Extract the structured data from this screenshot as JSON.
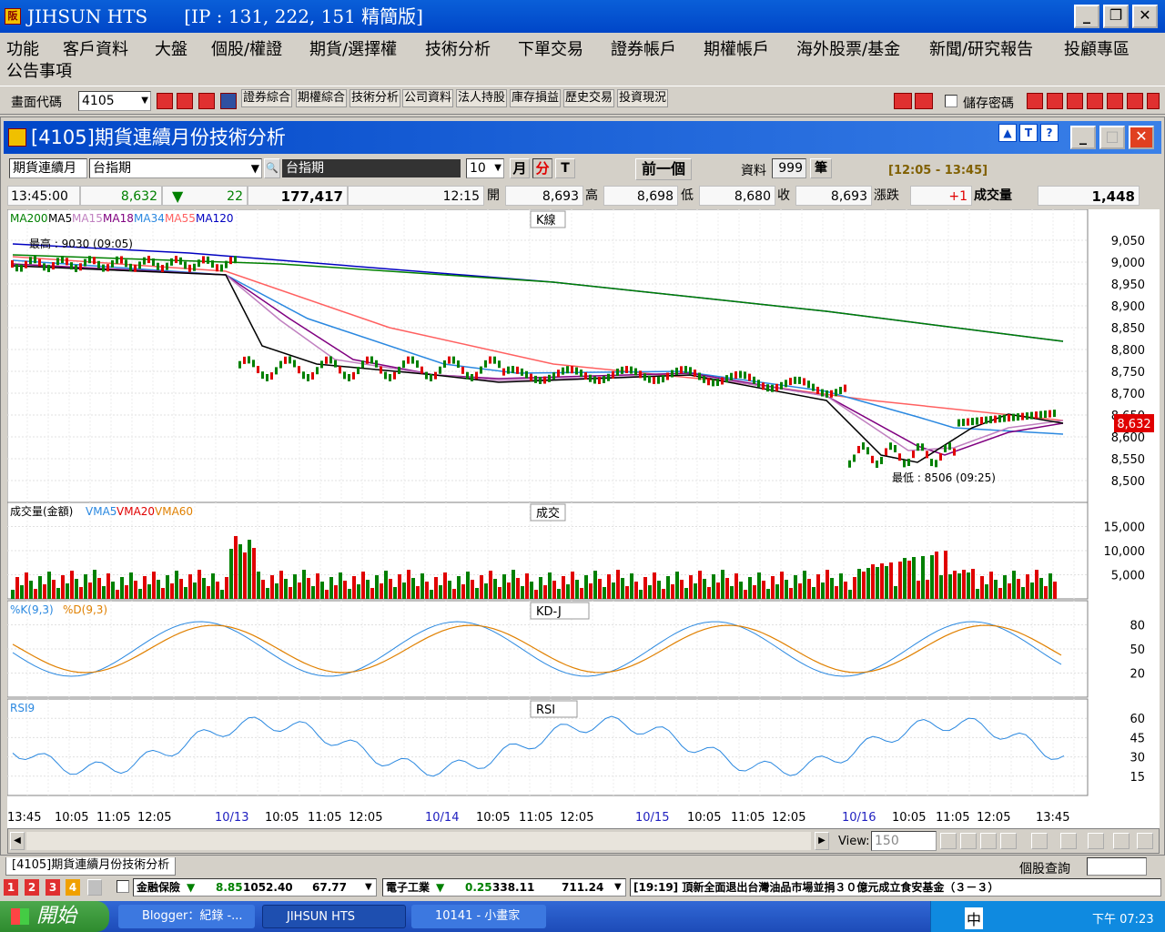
{
  "window": {
    "title": "JIHSUN HTS　　[IP : 131, 222, 151 精簡版]",
    "logo": "阪"
  },
  "menu": [
    "功能",
    "客戶資料",
    "大盤",
    "個股/權證",
    "期貨/選擇權",
    "技術分析",
    "下單交易",
    "證券帳戶",
    "期權帳戶",
    "海外股票/基金",
    "新聞/研究報告",
    "投顧專區",
    "公告事項"
  ],
  "toolbar": {
    "code_label": "畫面代碼",
    "code_value": "4105",
    "links": [
      "證券綜合",
      "期權綜合",
      "技術分析",
      "公司資料",
      "法人持股",
      "庫存損益",
      "歷史交易",
      "投資現況"
    ],
    "save_pw": "儲存密碼"
  },
  "child": {
    "title": "[4105]期貨連續月份技術分析"
  },
  "ctrl": {
    "type": "期貨連續月",
    "symbol": "台指期",
    "name": "台指期",
    "period": "10",
    "btn_month": "月",
    "btn_min": "分",
    "btn_t": "T",
    "prev": "前一個",
    "data_label": "資料",
    "data_value": "999",
    "data_unit": "筆",
    "time_range": "[12:05 - 13:45]"
  },
  "info": {
    "time": "13:45:00",
    "price": "8,632",
    "arrow": "▼",
    "change": "22",
    "volume_total": "177,417",
    "tick_time": "12:15",
    "open_l": "開",
    "open": "8,693",
    "high_l": "高",
    "high": "8,698",
    "low_l": "低",
    "low": "8,680",
    "close_l": "收",
    "close": "8,693",
    "chg_l": "漲跌",
    "chg": "+1",
    "vol_l": "成交量",
    "vol": "1,448"
  },
  "panels": {
    "k": {
      "title": "K線",
      "legend": [
        {
          "t": "MA200",
          "c": "#008000"
        },
        {
          "t": "MA5",
          "c": "#000000"
        },
        {
          "t": "MA15",
          "c": "#c080c0"
        },
        {
          "t": "MA18",
          "c": "#800080"
        },
        {
          "t": "MA34",
          "c": "#2a88e0"
        },
        {
          "t": "MA55",
          "c": "#ff6060"
        },
        {
          "t": "MA120",
          "c": "#0000c0"
        }
      ],
      "high_note": "最高 : 9030 (09:05)",
      "low_note": "最低 : 8506 (09:25)",
      "ticks": [
        "9,050",
        "9,000",
        "8,950",
        "8,900",
        "8,850",
        "8,800",
        "8,750",
        "8,700",
        "8,650",
        "8,600",
        "8,550",
        "8,500"
      ],
      "last": "8,632"
    },
    "vol": {
      "title": "成交",
      "legend": [
        {
          "t": "成交量(金額)",
          "c": "#000000"
        },
        {
          "t": "VMA5",
          "c": "#2a88e0"
        },
        {
          "t": "VMA20",
          "c": "#e00000"
        },
        {
          "t": "VMA60",
          "c": "#e08000"
        }
      ],
      "ticks": [
        "15,000",
        "10,000",
        "5,000"
      ]
    },
    "kd": {
      "title": "KD-J",
      "legend": [
        {
          "t": "%K(9,3)",
          "c": "#2a88e0"
        },
        {
          "t": "%D(9,3)",
          "c": "#e08000"
        }
      ],
      "ticks": [
        "80",
        "50",
        "20"
      ]
    },
    "rsi": {
      "title": "RSI",
      "legend": [
        {
          "t": "RSI9",
          "c": "#2a88e0"
        }
      ],
      "ticks": [
        "60",
        "45",
        "30",
        "15"
      ]
    }
  },
  "xaxis": [
    "13:45",
    "10:05",
    "11:05",
    "12:05",
    "10/13",
    "10:05",
    "11:05",
    "12:05",
    "10/14",
    "10:05",
    "11:05",
    "12:05",
    "10/15",
    "10:05",
    "11:05",
    "12:05",
    "10/16",
    "10:05",
    "11:05",
    "12:05",
    "13:45"
  ],
  "scroll": {
    "view_label": "View:",
    "view_value": "150"
  },
  "tabs": {
    "active": "[4105]期貨連續月份技術分析",
    "right": "個股查詢"
  },
  "ticker": {
    "pages": [
      "1",
      "2",
      "3",
      "4"
    ],
    "a_name": "金融保險",
    "a_arrow": "▼",
    "a_chg": "8.85",
    "a_val": "1052.40",
    "a_amt": "67.77",
    "b_name": "電子工業",
    "b_arrow": "▼",
    "b_chg": "0.25",
    "b_val": "338.11",
    "b_amt": "711.24",
    "news": "[19:19]  頂新全面退出台灣油品市場並捐３０億元成立食安基金（３－３）"
  },
  "taskbar": {
    "start": "開始",
    "tasks": [
      "Blogger：紀錄 -...",
      "JIHSUN HTS",
      "10141 - 小畫家"
    ],
    "ime": "中",
    "clock": "下午 07:23"
  }
}
